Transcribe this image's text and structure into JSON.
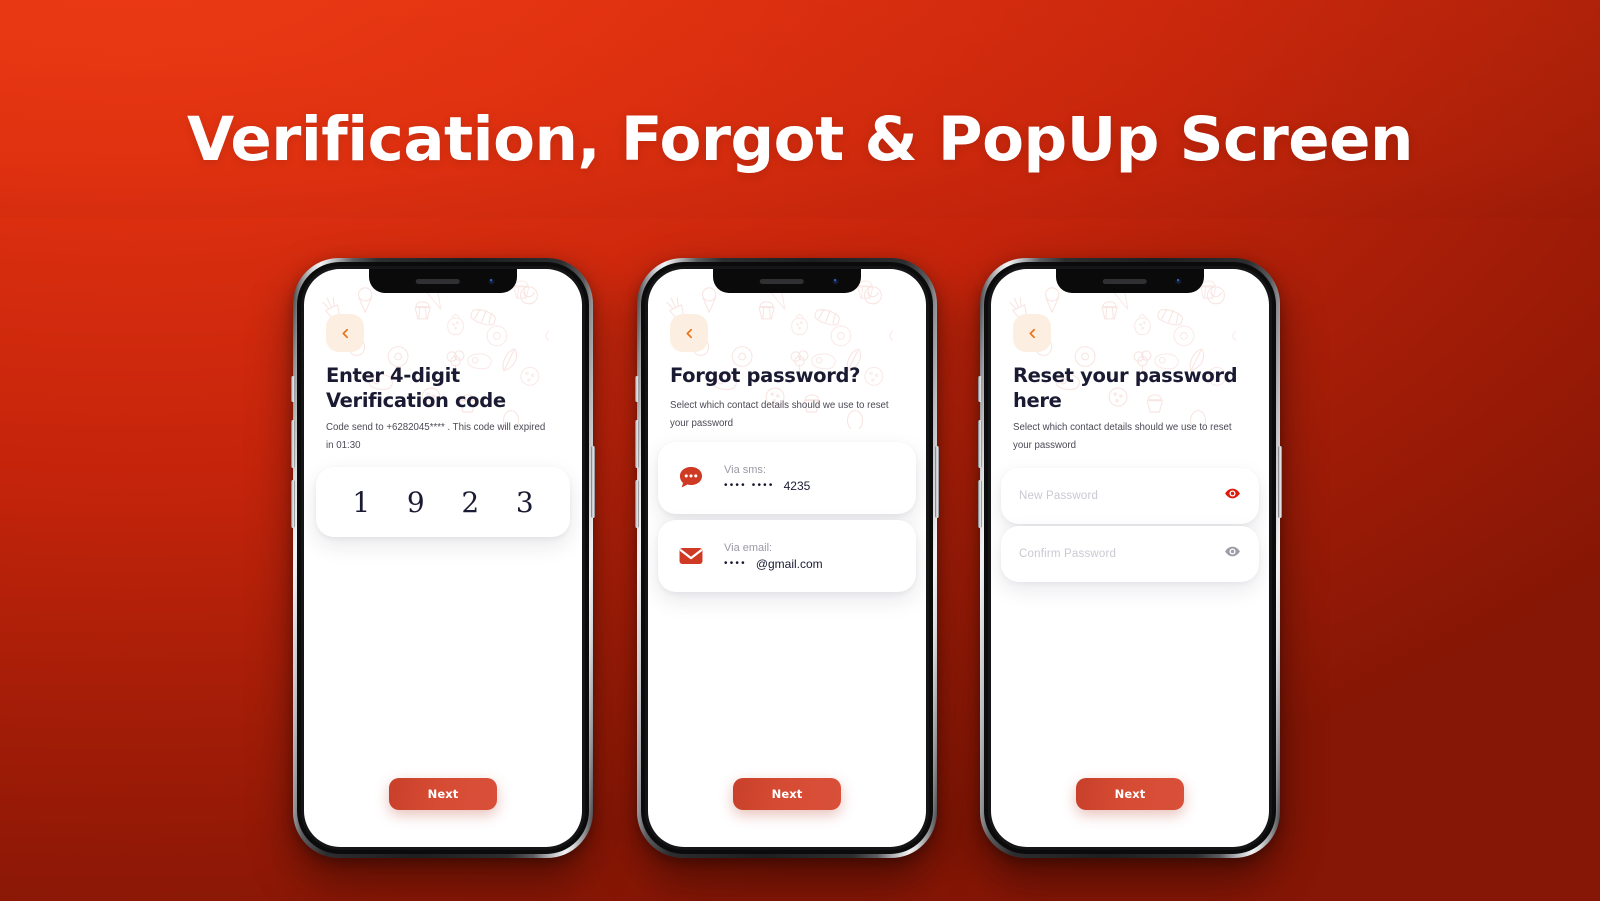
{
  "page": {
    "title": "Verification, Forgot & PopUp Screen",
    "background": {
      "from": "#EA3A14",
      "to": "#861605"
    },
    "accent": "#D64B33",
    "heading_color": "#1A1B33"
  },
  "icons": {
    "back": "chevron-left-icon",
    "sms": "chat-bubble-icon",
    "email": "envelope-icon",
    "eye_on": "eye-visible-icon",
    "eye_off": "eye-hidden-icon"
  },
  "screens": [
    {
      "id": "verification",
      "heading": "Enter 4-digit\nVerification code",
      "heading_line1": "Enter 4-digit",
      "heading_line2": "Verification code",
      "subtext": "Code send to +6282045**** . This code will expired in 01:30",
      "phone_number": "+6282045****",
      "expires_in": "01:30",
      "otp": {
        "digits": [
          "1",
          "9",
          "2",
          "3"
        ],
        "length": 4
      },
      "primary_button": "Next"
    },
    {
      "id": "forgot-password",
      "heading": "Forgot password?",
      "heading_line1": "Forgot password?",
      "heading_line2": "",
      "subtext": "Select which contact details should we use to reset your password",
      "options": [
        {
          "label": "Via sms:",
          "masked": "•••• ••••",
          "value": "4235",
          "icon": "chat-bubble-icon"
        },
        {
          "label": "Via email:",
          "masked": "••••",
          "value": "@gmail.com",
          "icon": "envelope-icon"
        }
      ],
      "primary_button": "Next"
    },
    {
      "id": "reset-password",
      "heading": "Reset your password here",
      "heading_line1": "Reset your password",
      "heading_line2": "here",
      "subtext": "Select which contact details should we use to reset your password",
      "fields": [
        {
          "placeholder": "New Password",
          "value": "",
          "reveal_state": "on"
        },
        {
          "placeholder": "Confirm Password",
          "value": "",
          "reveal_state": "off"
        }
      ],
      "primary_button": "Next"
    }
  ]
}
